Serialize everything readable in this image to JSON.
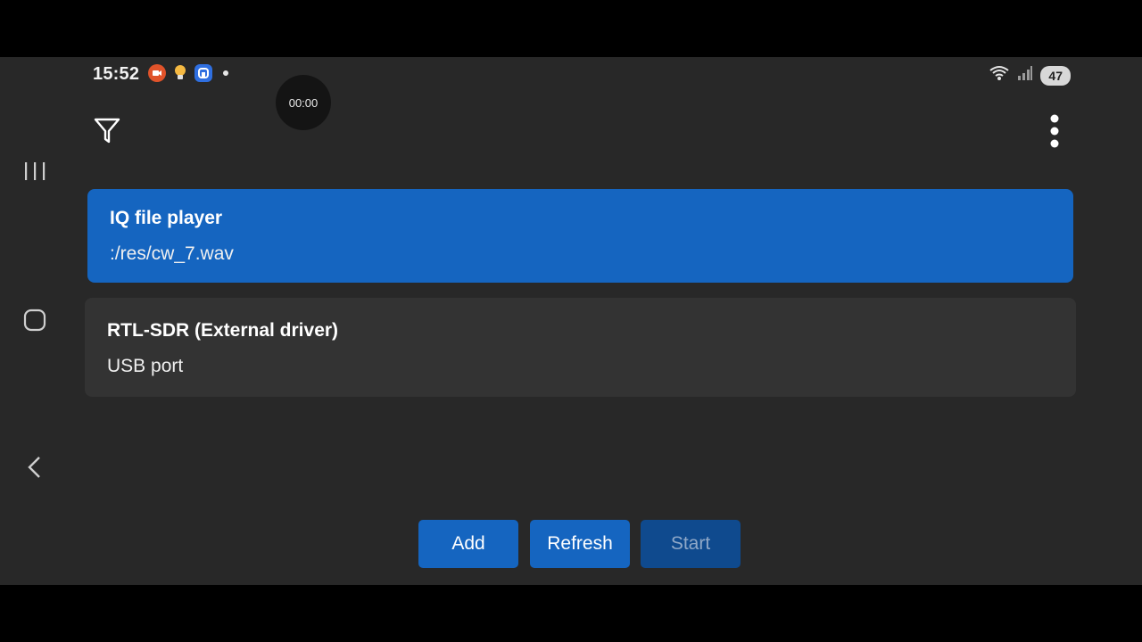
{
  "status_bar": {
    "time": "15:52",
    "notification_icons": [
      "screen-recorder-icon",
      "lightbulb-icon",
      "app-notification-icon"
    ],
    "battery": "47",
    "wifi_icon": "wifi-icon",
    "signal_icon": "cell-signal-icon"
  },
  "timer_bubble": "00:00",
  "toolbar": {
    "filter_icon": "filter-icon",
    "more_icon": "more-vert-icon"
  },
  "devices": [
    {
      "name": "IQ file player",
      "detail": ":/res/cw_7.wav",
      "selected": true
    },
    {
      "name": "RTL-SDR (External driver)",
      "detail": "USB port",
      "selected": false
    }
  ],
  "actions": {
    "add": "Add",
    "refresh": "Refresh",
    "start": "Start",
    "start_enabled": false
  },
  "navigation": {
    "recents_icon": "recents-icon",
    "home_icon": "home-icon",
    "back_icon": "back-icon"
  },
  "colors": {
    "accent": "#1565c0",
    "accent_disabled": "#0f4a8e",
    "background": "#282828",
    "card": "#333333"
  }
}
